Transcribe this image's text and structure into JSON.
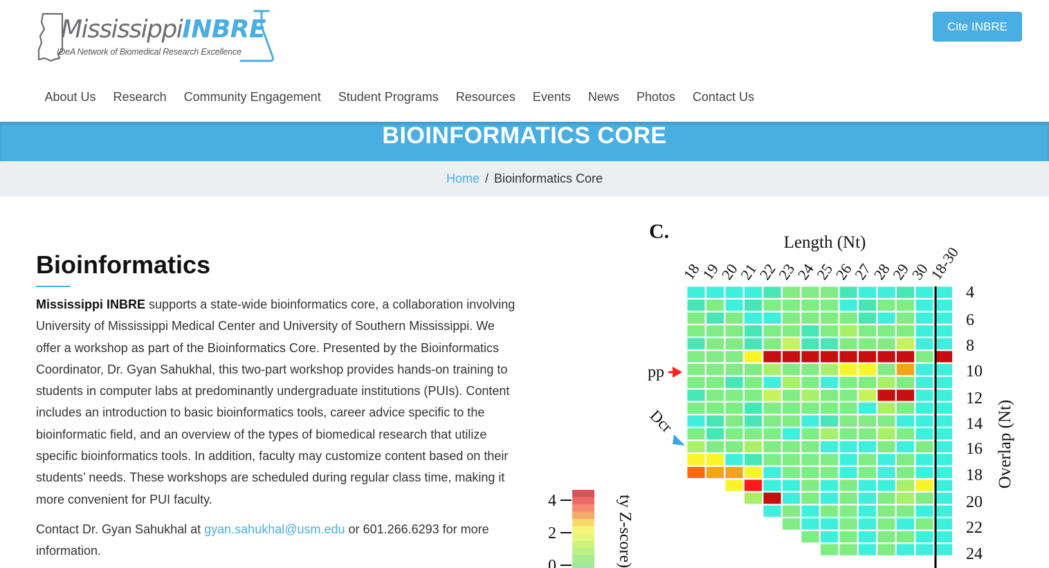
{
  "header": {
    "logo": {
      "name_part1": "Mississippi",
      "name_part2": "INBRE",
      "tagline": "IDeA Network of Biomedical Research Excellence"
    },
    "cite_button": "Cite INBRE",
    "nav": [
      "About Us",
      "Research",
      "Community Engagement",
      "Student Programs",
      "Resources",
      "Events",
      "News",
      "Photos",
      "Contact Us"
    ]
  },
  "page_title": "BIOINFORMATICS CORE",
  "breadcrumb": {
    "home": "Home",
    "separator": "/",
    "current": "Bioinformatics Core"
  },
  "content": {
    "heading": "Bioinformatics",
    "intro_bold": "Mississippi INBRE",
    "intro_rest": " supports a state-wide bioinformatics core, a collaboration involving University of Mississippi Medical Center and University of Southern Mississippi. We offer a workshop as part of the Bioinformatics Core. Presented by the Bioinformatics Coordinator, Dr. Gyan Sahukhal, this two-part workshop provides hands-on training to students in computer labs at predominantly undergraduate institutions (PUIs). Content includes an introduction to basic bioinformatics tools, career advice specific to the bioinformatic field, and an overview of the types of biomedical research that utilize specific bioinformatics tools. In addition, faculty may customize content based on their students’ needs. These workshops are scheduled during regular class time, making it more convenient for PUI faculty.",
    "contact_prefix": "Contact Dr. Gyan Sahukhal at ",
    "contact_email": "gyan.sahukhal@usm.edu",
    "contact_suffix": " or 601.266.6293 for more information."
  },
  "figure": {
    "panel_label": "C.",
    "top_label": "Length (Nt)",
    "right_label": "Overlap (Nt)",
    "colorbar_label": "ty Z-score)",
    "colorbar_ticks": [
      "4",
      "2",
      "0"
    ],
    "column_labels": [
      "18",
      "19",
      "20",
      "21",
      "22",
      "23",
      "24",
      "25",
      "26",
      "27",
      "28",
      "29",
      "30",
      "18-30"
    ],
    "row_labels": [
      "4",
      "6",
      "8",
      "10",
      "12",
      "14",
      "16",
      "18",
      "20",
      "22",
      "24"
    ],
    "annotations": [
      "pp",
      "Dcr"
    ],
    "colors": {
      "cyan": "#3ef0dc",
      "teal": "#47e6b5",
      "green": "#7fec84",
      "lightgreen": "#a8f06a",
      "yellowgreen": "#c6f35a",
      "yellow": "#f9f52a",
      "orange": "#f7a21d",
      "darkorange": "#f46c16",
      "red": "#ff1a1a",
      "darkred": "#c80f0f",
      "arrow_red": "#ff2020",
      "arrow_blue": "#3aa6e8"
    }
  }
}
